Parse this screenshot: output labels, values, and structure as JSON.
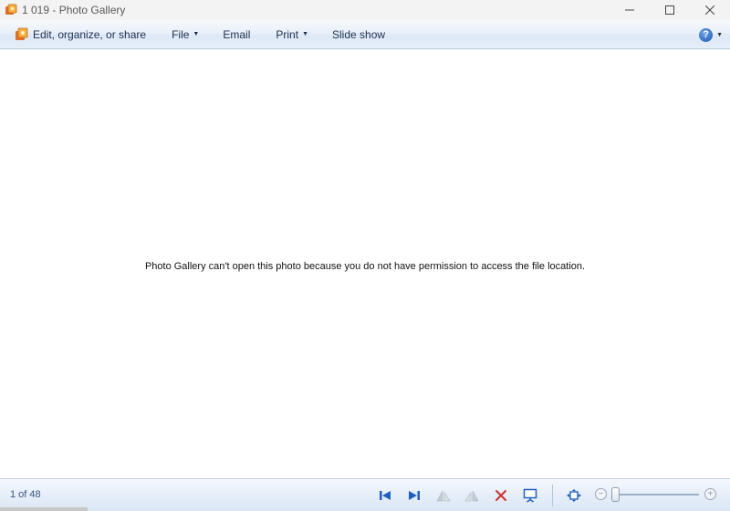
{
  "window": {
    "title": "1 019 - Photo Gallery",
    "icon": "photo-gallery-app-icon",
    "controls": [
      "minimize",
      "maximize",
      "close"
    ]
  },
  "commandbar": {
    "edit_label": "Edit, organize, or share",
    "file_label": "File",
    "email_label": "Email",
    "print_label": "Print",
    "slideshow_label": "Slide show",
    "help_label": "?"
  },
  "viewer": {
    "message": "Photo Gallery can't open this photo because you do not have permission to access the file location."
  },
  "statusbar": {
    "counter": "1 of 48",
    "tools": [
      "previous-icon",
      "next-icon",
      "rotate-left-icon",
      "rotate-right-icon",
      "delete-icon",
      "slideshow-icon",
      "actual-size-icon"
    ],
    "zoom_minus": "−",
    "zoom_plus": "+"
  },
  "colors": {
    "accent": "#1f5fbf",
    "delete": "#d03030",
    "counter_text": "#3a5480"
  }
}
